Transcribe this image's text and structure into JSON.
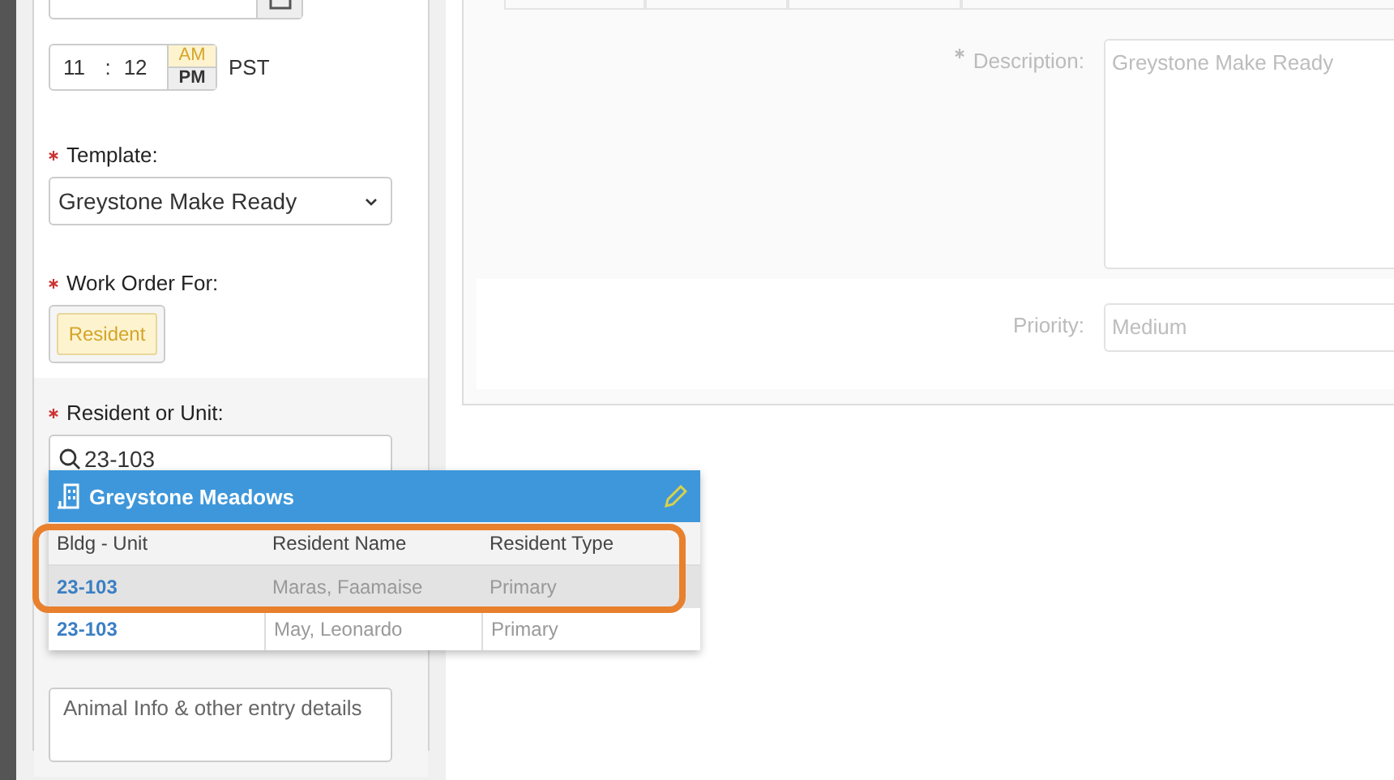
{
  "schedule": {
    "hour": "11",
    "separator": ":",
    "minute": "12",
    "ampm": [
      {
        "label": "AM",
        "selected": true
      },
      {
        "label": "PM",
        "selected": false
      }
    ],
    "timezone": "PST"
  },
  "template": {
    "label": "Template:",
    "required": true,
    "value": "Greystone Make Ready"
  },
  "work_order_for": {
    "label": "Work Order For:",
    "required": true,
    "options": [
      {
        "label": "Resident",
        "selected": true
      }
    ]
  },
  "resident_or_unit": {
    "label": "Resident or Unit:",
    "required": true,
    "value": "23-103"
  },
  "entry_details": {
    "placeholder": "Animal Info & other entry details"
  },
  "results": {
    "property": "Greystone Meadows",
    "columns": [
      "Bldg - Unit",
      "Resident Name",
      "Resident Type"
    ],
    "rows": [
      {
        "cells": [
          "23-103",
          "Maras, Faamaise",
          "Primary"
        ],
        "highlighted": true
      },
      {
        "cells": [
          "23-103",
          "May, Leonardo",
          "Primary"
        ],
        "highlighted": false
      }
    ]
  },
  "description": {
    "label": "Description:",
    "required": true,
    "value": "Greystone Make Ready",
    "disabled": true
  },
  "priority": {
    "label": "Priority:",
    "value": "Medium",
    "disabled": true
  }
}
